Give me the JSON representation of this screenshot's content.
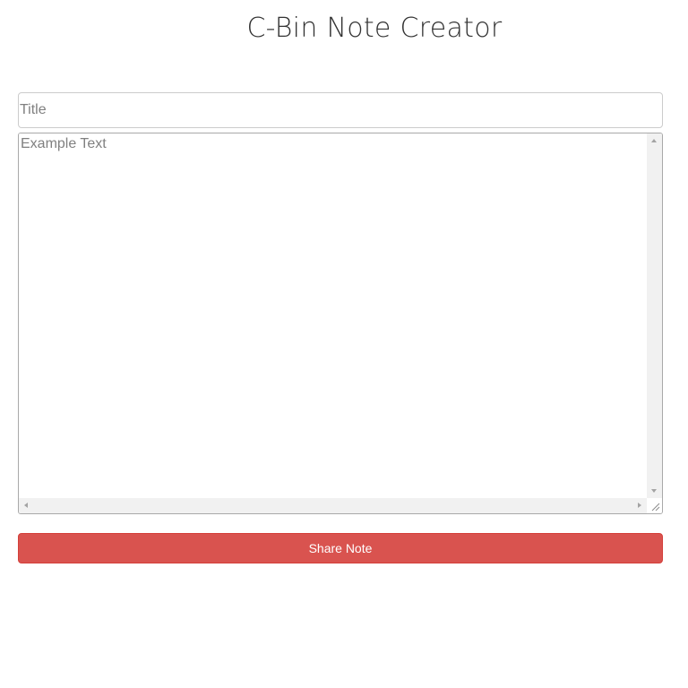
{
  "header": {
    "title": "C-Bin Note Creator"
  },
  "form": {
    "title_placeholder": "Title",
    "title_value": "",
    "body_placeholder": "Example Text",
    "body_value": "",
    "share_label": "Share Note"
  },
  "colors": {
    "share_button_bg": "#d9534f",
    "share_button_text": "#ffffff",
    "title_text": "#333333",
    "placeholder_text": "#808080"
  }
}
